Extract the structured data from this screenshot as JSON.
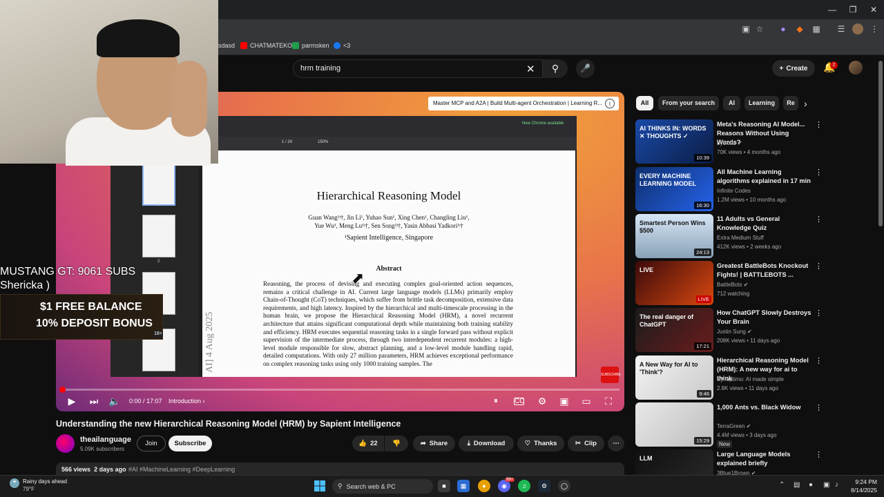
{
  "browser": {
    "bookmarks": [
      {
        "label": "sdasd"
      },
      {
        "label": "CHATMATEKO"
      },
      {
        "label": "parmsken"
      },
      {
        "label": "<3"
      }
    ]
  },
  "header": {
    "search_value": "hrm training",
    "create_label": "Create",
    "notification_count": "2"
  },
  "player": {
    "video_card": "Master MCP and A2A | Build Multi-agent Orchestration | Learning R...",
    "pdf_page_indicator": "1 / 24",
    "pdf_zoom": "150%",
    "pdf_banner": "New Chrome available",
    "paper": {
      "title": "Hierarchical Reasoning Model",
      "authors_1": "Guan Wang¹ʲ†, Jin Li¹, Yuhao Sun¹, Xing Chen¹, Changling Liu¹,",
      "authors_2": "Yue Wu¹, Meng Lu¹ʲ†, Sen Song²ʲ†, Yasin Abbasi Yadkori¹ʲ†",
      "affiliation": "¹Sapient Intelligence, Singapore",
      "abstract_heading": "Abstract",
      "abstract": "Reasoning, the process of devising and executing complex goal-oriented action sequences, remains a critical challenge in AI. Current large language models (LLMs) primarily employ Chain-of-Thought (CoT) techniques, which suffer from brittle task decomposition, extensive data requirements, and high latency. Inspired by the hierarchical and multi-timescale processing in the human brain, we propose the Hierarchical Reasoning Model (HRM), a novel recurrent architecture that attains significant computational depth while maintaining both training stability and efficiency. HRM executes sequential reasoning tasks in a single forward pass without explicit supervision of the intermediate process, through two interdependent recurrent modules: a high-level module responsible for slow, abstract planning, and a low-level module handling rapid, detailed computations. With only 27 million parameters, HRM achieves exceptional performance on complex reasoning tasks using only 1000 training samples. The",
      "arxiv_side": "AI]  4 Aug 2025",
      "thumb_labels": [
        "1",
        "2"
      ]
    },
    "subscribe_logo": "SUBSCRIBE",
    "time": "0:00 / 17:07",
    "chapter": "Introduction",
    "progress": 0.0
  },
  "overlay": {
    "line1": "MUSTANG GT: 9061 SUBS",
    "line2": "Shericka )",
    "bonus_1": "$1 FREE BALANCE",
    "bonus_2": "10% DEPOSIT BONUS",
    "age_badge": "18+"
  },
  "video": {
    "title": "Understanding the new Hierarchical Reasoning Model (HRM) by Sapient Intelligence",
    "channel": "theailanguage",
    "subscribers": "5.09K subscribers",
    "join": "Join",
    "subscribe": "Subscribe",
    "likes": "22",
    "share": "Share",
    "download": "Download",
    "thanks": "Thanks",
    "clip": "Clip",
    "views": "566 views",
    "age": "2 days ago",
    "tags": "#AI #MachineLearning #DeepLearning"
  },
  "chips": [
    "All",
    "From your search",
    "AI",
    "Learning",
    "Re"
  ],
  "related": [
    {
      "title": "Meta's Reasoning AI Model... Reasons Without Using Words?",
      "channel": "bycloud",
      "meta": "70K views • 4 months ago",
      "duration": "10:39",
      "thumb_text": "AI THINKS IN: WORDS ✕ THOUGHTS ✓",
      "verified": true
    },
    {
      "title": "All Machine Learning algorithms explained in 17 min",
      "channel": "Infinite Codes",
      "meta": "1.2M views • 10 months ago",
      "duration": "16:30",
      "thumb_text": "EVERY MACHINE LEARNING MODEL",
      "verified": false
    },
    {
      "title": "11 Adults vs General Knowledge Quiz",
      "channel": "Extra Medium Stuff",
      "meta": "412K views • 2 weeks ago",
      "duration": "24:13",
      "thumb_text": "Smartest Person Wins $500",
      "verified": false
    },
    {
      "title": "Greatest BattleBots Knockout Fights! | BATTLEBOTS ...",
      "channel": "BattleBots",
      "meta": "712 watching",
      "duration": "LIVE",
      "thumb_text": "LIVE",
      "verified": true
    },
    {
      "title": "How ChatGPT Slowly Destroys Your Brain",
      "channel": "Justin Sung",
      "meta": "208K views • 11 days ago",
      "duration": "17:21",
      "thumb_text": "The real danger of ChatGPT",
      "verified": true
    },
    {
      "title": "Hierarchical Reasoning Model (HRM): A new way for ai to think",
      "channel": "Synaptimo: AI made simple",
      "meta": "2.8K views • 11 days ago",
      "duration": "9:46",
      "thumb_text": "A New Way for AI to 'Think'?",
      "verified": false
    },
    {
      "title": "1,000 Ants vs. Black Widow",
      "channel": "TerraGreen",
      "meta": "4.4M views • 3 days ago",
      "duration": "15:29",
      "thumb_text": "",
      "verified": true,
      "badge": "New"
    },
    {
      "title": "Large Language Models explained briefly",
      "channel": "3Blue1Brown",
      "meta": "",
      "duration": "",
      "thumb_text": "LLM",
      "verified": true
    }
  ],
  "taskbar": {
    "weather_1": "Rainy days ahead",
    "weather_2": "79°F",
    "search_placeholder": "Search web & PC",
    "time": "9:24 PM",
    "date": "8/14/2025",
    "discord_badge": "99+"
  },
  "colors": {
    "yt_red": "#ff0000",
    "accent_bg": "#0f0f0f",
    "chip_active": "#f1f1f1"
  }
}
